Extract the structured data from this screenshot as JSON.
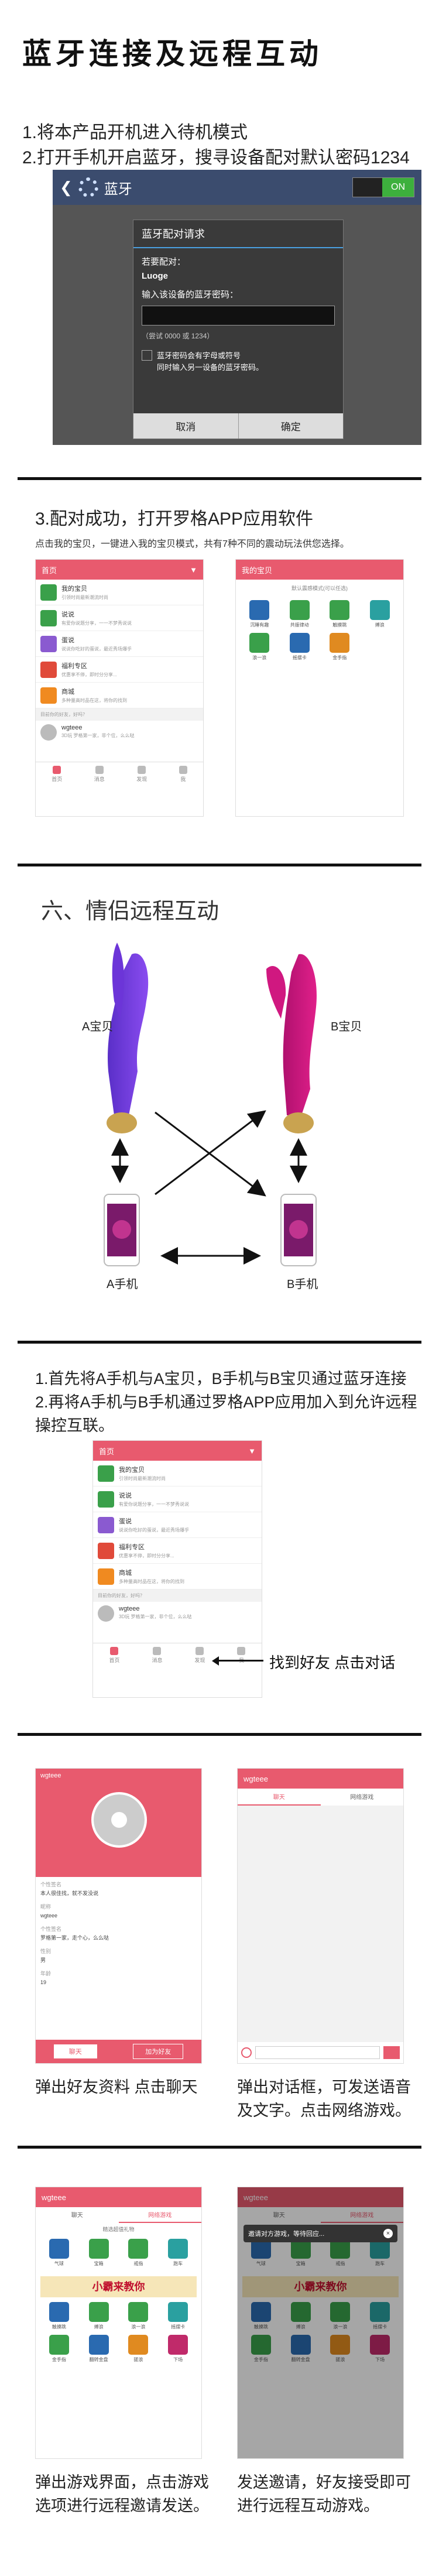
{
  "title": "蓝牙连接及远程互动",
  "steps": {
    "s1": "1.将本产品开机进入待机模式",
    "s2": "2.打开手机开启蓝牙，搜寻设备配对默认密码1234",
    "s3": "3.配对成功，打开罗格APP应用软件",
    "s3_sub": "点击我的宝贝，一键进入我的宝贝模式，共有7种不同的震动玩法供您选择。"
  },
  "bt": {
    "back_glyph": "❮",
    "title": "蓝牙",
    "toggle": "ON",
    "dlg_title": "蓝牙配对请求",
    "pair_label": "若要配对：",
    "device": "Luoge",
    "pin_label": "输入该设备的蓝牙密码：",
    "pin_hint": "（尝试 0000 或 1234）",
    "chk1": "蓝牙密码会有字母或符号",
    "chk2": "同时输入另一设备的蓝牙密码。",
    "cancel": "取消",
    "ok": "确定"
  },
  "app": {
    "header": "首页",
    "rows": [
      {
        "t": "我的宝贝",
        "s": "引领时尚最新潮流时尚"
      },
      {
        "t": "说说",
        "s": "有爱你说题分享，一一不梦秀说说"
      },
      {
        "t": "蛋说",
        "s": "说说你吃好的蛋说，最近秀场爆乎"
      },
      {
        "t": "福利专区",
        "s": "优惠享不停，即时分分享..."
      },
      {
        "t": "商城",
        "s": "多种量高时品在这，将你的找到"
      }
    ],
    "friend_bar": "目前你的好友，好吗？",
    "feed_name": "wgteee",
    "feed_text": "3D玩 罗格第一家，非个位，么么哒",
    "tabs": [
      "首页",
      "消息",
      "发现",
      "我"
    ],
    "baby_header": "我的宝贝",
    "baby_sub": "默认震感模式(可以任选)",
    "modes": [
      "沉睡有趣",
      "共振律动",
      "触摸跳",
      "搏浪",
      "浪一浪",
      "摇摆卡",
      "金手指"
    ]
  },
  "section6": "六、情侣远程互动",
  "labels": {
    "a_bao": "A宝贝",
    "b_bao": "B宝贝",
    "a_phone": "A手机",
    "b_phone": "B手机"
  },
  "steps2": {
    "l1": "1.首先将A手机与A宝贝，B手机与B宝贝通过蓝牙连接",
    "l2": "2.再将A手机与B手机通过罗格APP应用加入到允许远程",
    "l3": "操控互联。",
    "find": "找到好友 点击对话"
  },
  "profile": {
    "name": "wgteee",
    "intro_label": "个性签名",
    "intro": "本人很佳找，就不发没说",
    "nick_label": "昵称",
    "nick": "wgteee",
    "sign_label": "个性签名",
    "sign": "罗格第一家，走个心，么么哒",
    "gender_label": "性别",
    "gender": "男",
    "age_label": "年龄",
    "age": "19",
    "chat": "聊天",
    "add": "加为好友"
  },
  "chat": {
    "name": "wgteee",
    "tab1": "聊天",
    "tab2": "网络游戏"
  },
  "cap1": [
    "弹出好友资料 点击聊天"
  ],
  "cap2": [
    "弹出对话框，可发送语音",
    "及文字。点击网络游戏。"
  ],
  "game": {
    "name": "wgteee",
    "tab1": "聊天",
    "tab2": "网络游戏",
    "sec": "精选超值礼物",
    "gifts": [
      "气球",
      "宝箱",
      "戒指",
      "跑车"
    ],
    "banner": "小霸来教你",
    "modes": [
      "触摸跳",
      "搏浪",
      "浪一浪",
      "摇摆卡",
      "金手指",
      "翻转金盘",
      "搓浪",
      "下场"
    ],
    "invite": "邀请对方游戏，等待回应..."
  },
  "cap3": [
    "弹出游戏界面，点击游戏",
    "选项进行远程邀请发送。"
  ],
  "cap4": [
    "发送邀请，好友接受即可",
    "进行远程互动游戏。"
  ],
  "colors": {
    "accent": "#e85a6e",
    "bt_bar": "#3b4c6e",
    "toggle": "#3db03d"
  }
}
